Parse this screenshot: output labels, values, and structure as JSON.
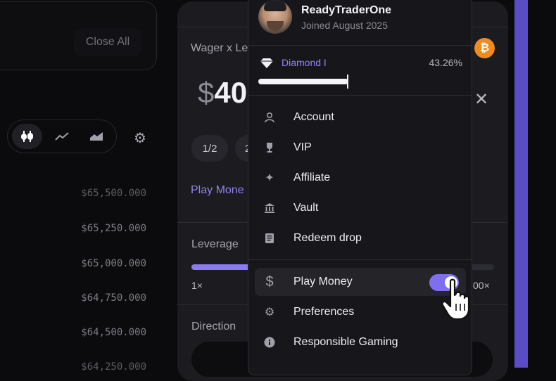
{
  "positions": {
    "close_all_label": "Close All"
  },
  "chart_toolbar": {
    "chart_types": [
      {
        "icon": "candlestick-icon",
        "active": true
      },
      {
        "icon": "line-chart-icon",
        "active": false
      },
      {
        "icon": "area-chart-icon",
        "active": false
      }
    ],
    "settings_icon": "gear-icon"
  },
  "price_axis": [
    "$65,500.000",
    "$65,250.000",
    "$65,000.000",
    "$64,750.000",
    "$64,500.000",
    "$64,250.000"
  ],
  "bet_panel": {
    "wager_label": "Wager x Le",
    "amount_symbol": "$",
    "amount_value": "40",
    "chip_half": "1/2",
    "chip_double": "2",
    "play_money_link": "Play Mone",
    "leverage_label": "Leverage",
    "leverage_min": "1×",
    "leverage_max": "00×",
    "leverage_fill": 0.2,
    "direction_label": "Direction",
    "currency_icon": "bitcoin-icon",
    "close_icon": "close-icon"
  },
  "user_menu": {
    "username": "ReadyTraderOne",
    "joined": "Joined August 2025",
    "tier": "Diamond I",
    "tier_percent": "43.26%",
    "tier_progress": 0.43,
    "items": [
      {
        "label": "Account",
        "icon": "user-icon"
      },
      {
        "label": "VIP",
        "icon": "trophy-icon"
      },
      {
        "label": "Affiliate",
        "icon": "sparkle-icon"
      },
      {
        "label": "Vault",
        "icon": "bank-icon"
      },
      {
        "label": "Redeem drop",
        "icon": "receipt-icon"
      }
    ],
    "settings_items": [
      {
        "label": "Play Money",
        "icon": "dollar-icon",
        "toggle": true
      },
      {
        "label": "Preferences",
        "icon": "gear-icon"
      },
      {
        "label": "Responsible Gaming",
        "icon": "info-icon"
      }
    ]
  },
  "colors": {
    "accent": "#8a7cf0",
    "tier_color": "#8f86f4",
    "bitcoin": "#f08c1e"
  }
}
